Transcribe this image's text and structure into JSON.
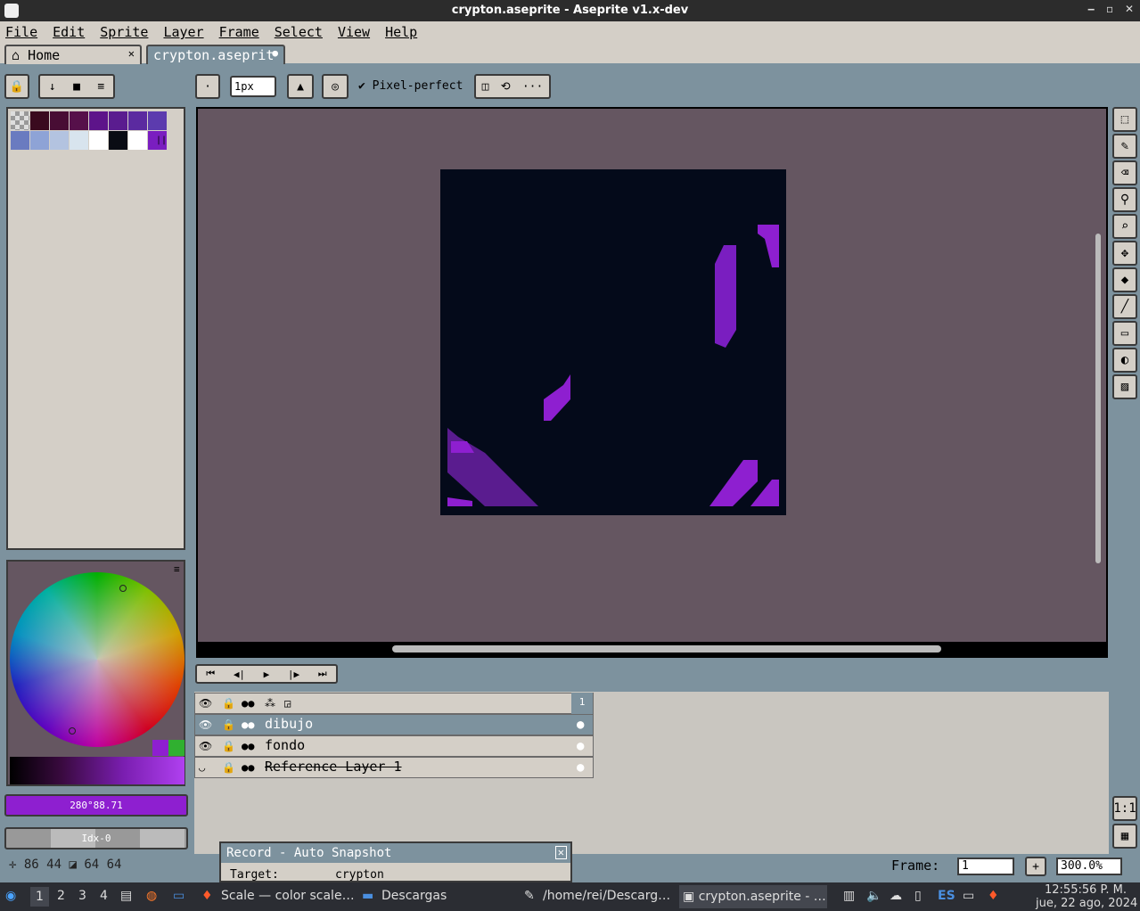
{
  "window": {
    "title": "crypton.aseprite - Aseprite v1.x-dev",
    "minimize": "‒",
    "restore": "▫",
    "close": "✕"
  },
  "menu": [
    "File",
    "Edit",
    "Sprite",
    "Layer",
    "Frame",
    "Select",
    "View",
    "Help"
  ],
  "tabs": {
    "home": "Home",
    "home_close": "✕",
    "file": "crypton.aseprit",
    "file_modified": "●"
  },
  "toolbar": {
    "brush_size": "1px",
    "pixel_perfect": "Pixel-perfect",
    "more": "···"
  },
  "palette_colors": [
    "#c8c8c8",
    "#3a0a1e",
    "#480d34",
    "#56104a",
    "#5d148a",
    "#5a1c8f",
    "#5b2aa0",
    "#5c3bae",
    "#6a7bc0",
    "#8ea3d6",
    "#b3c3e0",
    "#d8e4ee",
    "#ffffff",
    "#0a0c14",
    "#ffffff",
    "#7a1ec0"
  ],
  "color_value": "280°88.71",
  "index_value": "Idx-0",
  "playback": [
    "⏮",
    "◀|",
    "▶",
    "|▶",
    "⏭"
  ],
  "layers": {
    "frame_number": "1",
    "rows": [
      {
        "name": "dibujo",
        "selected": true,
        "strike": false
      },
      {
        "name": "fondo",
        "selected": false,
        "strike": false
      },
      {
        "name": "Reference Layer 1",
        "selected": false,
        "strike": true
      }
    ]
  },
  "record_panel": {
    "title": "Record - Auto Snapshot",
    "target_label": "Target:",
    "target_value": "crypton"
  },
  "status": {
    "cursor": "86 44",
    "size": "64 64",
    "frame_label": "Frame:",
    "frame_value": "1",
    "zoom": "300.0%"
  },
  "tool_icons": [
    "marquee-icon",
    "pencil-icon",
    "eraser-icon",
    "eyedropper-icon",
    "zoom-icon",
    "move-icon",
    "fill-icon",
    "line-icon",
    "rectangle-icon",
    "blur-icon",
    "spray-icon"
  ],
  "right_buttons": [
    "1:1"
  ],
  "taskbar": {
    "workspaces": [
      "1",
      "2",
      "3",
      "4"
    ],
    "items": [
      "Scale — color scale…",
      "Descargas",
      "/home/rei/Descarg…",
      "crypton.aseprite - …"
    ],
    "lang": "ES",
    "time": "12:55:56 P. M.",
    "date": "jue, 22 ago, 2024"
  },
  "colors": {
    "accent": "#8e1fd0",
    "canvas_bg": "#655661",
    "sprite_bg": "#040a1a",
    "purple_dark": "#5a1c8f"
  }
}
